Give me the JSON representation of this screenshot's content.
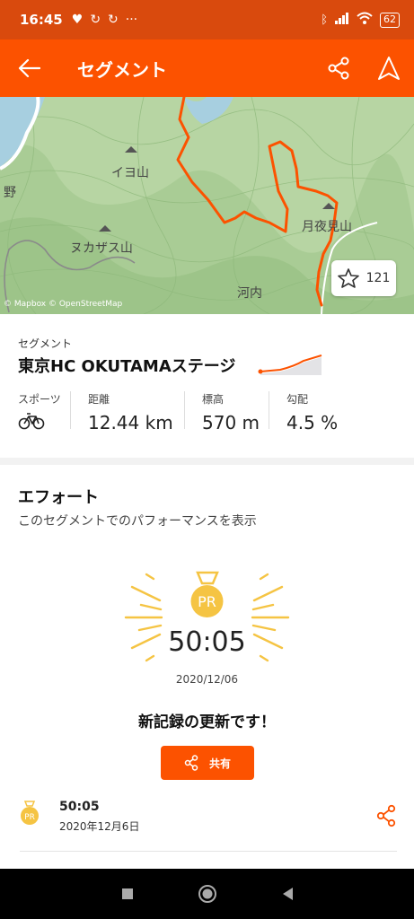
{
  "status": {
    "time": "16:45",
    "battery": "62",
    "left_icons": [
      "heart-icon",
      "sync-icon",
      "sync-icon",
      "more-dots-icon"
    ],
    "right_icons": [
      "bluetooth-icon",
      "signal-icon",
      "wifi-icon",
      "battery-icon"
    ]
  },
  "appbar": {
    "title": "セグメント"
  },
  "map": {
    "labels": {
      "iyo": "イヨ山",
      "nukazasu": "ヌカザス山",
      "tsukiyomi": "月夜見山",
      "kawachi": "河内",
      "no": "野"
    },
    "star_count": "121",
    "attribution": "© Mapbox © OpenStreetMap"
  },
  "segment": {
    "label": "セグメント",
    "name": "東京HC OKUTAMAステージ",
    "stats": [
      {
        "label": "スポーツ",
        "value": "",
        "icon": "bicycle-icon"
      },
      {
        "label": "距離",
        "value": "12.44 km"
      },
      {
        "label": "標高",
        "value": "570 m"
      },
      {
        "label": "勾配",
        "value": "4.5 %"
      }
    ]
  },
  "effort": {
    "title": "エフォート",
    "subtitle": "このセグメントでのパフォーマンスを表示",
    "pr_badge": "PR",
    "pr_time": "50:05",
    "pr_date": "2020/12/06",
    "new_record": "新記録の更新です！",
    "share_label": "共有",
    "list": [
      {
        "badge": "PR",
        "time": "50:05",
        "date": "2020年12月6日"
      }
    ]
  },
  "colors": {
    "accent": "#fc5200",
    "statusbar": "#d94a0d",
    "gold": "#f5c443"
  }
}
